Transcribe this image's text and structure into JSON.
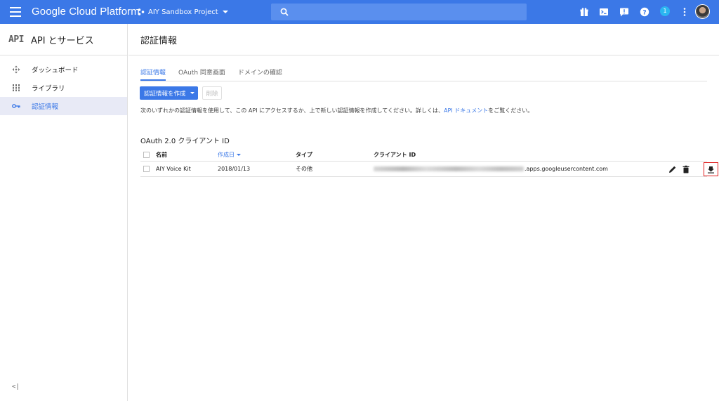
{
  "topbar": {
    "brand": "Google Cloud Platform",
    "project_name": "AIY Sandbox Project",
    "search_placeholder": "",
    "notification_count": "1",
    "icons": [
      "menu-icon",
      "gift-icon",
      "cloud-shell-icon",
      "feedback-icon",
      "help-icon",
      "more-vert-icon",
      "avatar"
    ]
  },
  "sidebar": {
    "logo": "API",
    "title": "API とサービス",
    "items": [
      {
        "label": "ダッシュボード",
        "icon": "dashboard-icon"
      },
      {
        "label": "ライブラリ",
        "icon": "library-icon"
      },
      {
        "label": "認証情報",
        "icon": "key-icon",
        "active": true
      }
    ],
    "collapse_label": "<|"
  },
  "main": {
    "title": "認証情報",
    "tabs": [
      {
        "label": "認証情報",
        "active": true
      },
      {
        "label": "OAuth 同意画面"
      },
      {
        "label": "ドメインの確認"
      }
    ],
    "create_button": "認証情報を作成",
    "delete_button": "削除",
    "description": {
      "text_before": "次のいずれかの認証情報を使用して、この API にアクセスするか、上で新しい認証情報を作成してください。詳しくは、",
      "link": "API ドキュメント",
      "text_after": "をご覧ください。"
    },
    "section_title": "OAuth 2.0 クライアント ID",
    "table": {
      "columns": [
        "名前",
        "作成日",
        "タイプ",
        "クライアント ID"
      ],
      "rows": [
        {
          "name": "AIY Voice Kit",
          "created": "2018/01/13",
          "type": "その他",
          "client_id_suffix": ".apps.googleusercontent.com"
        }
      ]
    }
  },
  "colors": {
    "brand_blue": "#3b78e7",
    "highlight_red": "#e02020",
    "badge": "#2bb6f0"
  }
}
